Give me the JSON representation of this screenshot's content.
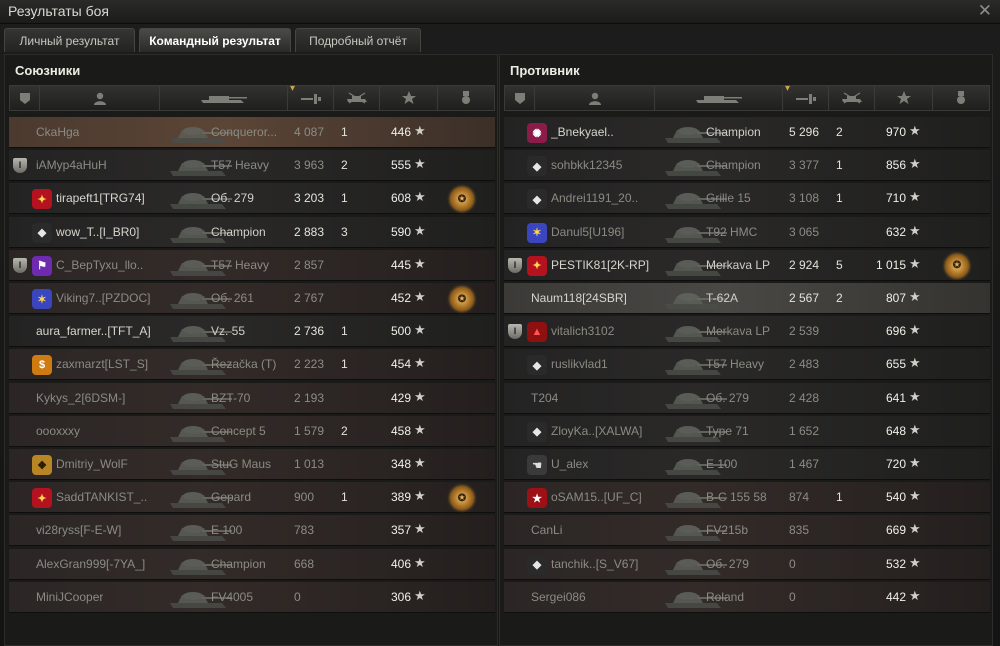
{
  "window": {
    "title": "Результаты боя",
    "close_glyph": "✕"
  },
  "tabs": [
    {
      "label": "Личный результат",
      "active": false
    },
    {
      "label": "Командный результат",
      "active": true
    },
    {
      "label": "Подробный отчёт",
      "active": false
    }
  ],
  "allies": {
    "title": "Союзники",
    "rows": [
      {
        "player": "CkaHga",
        "vehicle": "Conqueror...",
        "damage": "4 087",
        "kills": "1",
        "xp": "446",
        "style": "self",
        "badge": false,
        "clan_icon": "",
        "medal": false,
        "dead": true
      },
      {
        "player": "iAMyp4aHuH",
        "vehicle": "T57 Heavy",
        "damage": "3 963",
        "kills": "2",
        "xp": "555",
        "style": "",
        "badge": true,
        "clan_icon": "",
        "medal": false,
        "dead": true
      },
      {
        "player": "tirapeft1[TRG74]",
        "vehicle": "Об. 279",
        "damage": "3 203",
        "kills": "1",
        "xp": "608",
        "style": "",
        "badge": false,
        "clan_icon": "clan-emblem-red",
        "medal": true,
        "dead": false
      },
      {
        "player": "wow_T..[I_BR0]",
        "vehicle": "Champion",
        "damage": "2 883",
        "kills": "3",
        "xp": "590",
        "style": "",
        "badge": false,
        "clan_icon": "clan-emblem-diamond",
        "medal": false,
        "dead": false
      },
      {
        "player": "C_BepTyxu_llo..",
        "vehicle": "T57 Heavy",
        "damage": "2 857",
        "kills": "",
        "xp": "445",
        "style": "alt",
        "badge": true,
        "clan_icon": "clan-emblem-flag",
        "medal": false,
        "dead": true
      },
      {
        "player": "Viking7..[PZDOC]",
        "vehicle": "Об. 261",
        "damage": "2 767",
        "kills": "",
        "xp": "452",
        "style": "alt",
        "badge": false,
        "clan_icon": "clan-emblem-blue",
        "medal": true,
        "dead": true
      },
      {
        "player": "aura_farmer..[TFT_A]",
        "vehicle": "Vz. 55",
        "damage": "2 736",
        "kills": "1",
        "xp": "500",
        "style": "",
        "badge": false,
        "clan_icon": "",
        "medal": false,
        "dead": false
      },
      {
        "player": "zaxmarzt[LST_S]",
        "vehicle": "Řezačka (T)",
        "damage": "2 223",
        "kills": "1",
        "xp": "454",
        "style": "alt",
        "badge": false,
        "clan_icon": "clan-emblem-dollar",
        "medal": false,
        "dead": true
      },
      {
        "player": "Kykys_2[6DSM-]",
        "vehicle": "BZT-70",
        "damage": "2 193",
        "kills": "",
        "xp": "429",
        "style": "alt",
        "badge": false,
        "clan_icon": "",
        "medal": false,
        "dead": true
      },
      {
        "player": "oooxxxy",
        "vehicle": "Concept 5",
        "damage": "1 579",
        "kills": "2",
        "xp": "458",
        "style": "alt",
        "badge": false,
        "clan_icon": "",
        "medal": false,
        "dead": true
      },
      {
        "player": "Dmitriy_WolF",
        "vehicle": "StuG Maus",
        "damage": "1 013",
        "kills": "",
        "xp": "348",
        "style": "alt",
        "badge": false,
        "clan_icon": "clan-emblem-gold",
        "medal": false,
        "dead": true
      },
      {
        "player": "SaddTANKIST_..",
        "vehicle": "Gepard",
        "damage": "900",
        "kills": "1",
        "xp": "389",
        "style": "alt",
        "badge": false,
        "clan_icon": "clan-emblem-red",
        "medal": true,
        "dead": true
      },
      {
        "player": "vi28ryss[F-E-W]",
        "vehicle": "E 100",
        "damage": "783",
        "kills": "",
        "xp": "357",
        "style": "alt",
        "badge": false,
        "clan_icon": "",
        "medal": false,
        "dead": true
      },
      {
        "player": "AlexGran999[-7YA_]",
        "vehicle": "Champion",
        "damage": "668",
        "kills": "",
        "xp": "406",
        "style": "alt",
        "badge": false,
        "clan_icon": "",
        "medal": false,
        "dead": true
      },
      {
        "player": "MiniJCooper",
        "vehicle": "FV4005",
        "damage": "0",
        "kills": "",
        "xp": "306",
        "style": "alt",
        "badge": false,
        "clan_icon": "",
        "medal": false,
        "dead": true
      }
    ]
  },
  "enemies": {
    "title": "Противник",
    "rows": [
      {
        "player": "_Bnekyael..",
        "vehicle": "Champion",
        "damage": "5 296",
        "kills": "2",
        "xp": "970",
        "style": "",
        "badge": false,
        "clan_icon": "clan-emblem-pink",
        "medal": false,
        "dead": false
      },
      {
        "player": "sohbkk12345",
        "vehicle": "Champion",
        "damage": "3 377",
        "kills": "1",
        "xp": "856",
        "style": "",
        "badge": false,
        "clan_icon": "clan-emblem-diamond",
        "medal": false,
        "dead": true
      },
      {
        "player": "Andrei1191_20..",
        "vehicle": "Grille 15",
        "damage": "3 108",
        "kills": "1",
        "xp": "710",
        "style": "",
        "badge": false,
        "clan_icon": "clan-emblem-diamond",
        "medal": false,
        "dead": true
      },
      {
        "player": "Danul5[U196]",
        "vehicle": "T92 HMC",
        "damage": "3 065",
        "kills": "",
        "xp": "632",
        "style": "",
        "badge": false,
        "clan_icon": "clan-emblem-blue",
        "medal": false,
        "dead": true
      },
      {
        "player": "PESTIK81[2K-RP]",
        "vehicle": "Merkava LP",
        "damage": "2 924",
        "kills": "5",
        "xp": "1 015",
        "style": "",
        "badge": true,
        "clan_icon": "clan-emblem-red",
        "medal": true,
        "dead": false
      },
      {
        "player": "Naum118[24SBR]",
        "vehicle": "T-62A",
        "damage": "2 567",
        "kills": "2",
        "xp": "807",
        "style": "enemyself",
        "badge": false,
        "clan_icon": "",
        "medal": false,
        "dead": false
      },
      {
        "player": "vitalich3102",
        "vehicle": "Merkava LP",
        "damage": "2 539",
        "kills": "",
        "xp": "696",
        "style": "",
        "badge": true,
        "clan_icon": "clan-emblem-warning",
        "medal": false,
        "dead": true
      },
      {
        "player": "ruslikvlad1",
        "vehicle": "T57 Heavy",
        "damage": "2 483",
        "kills": "",
        "xp": "655",
        "style": "",
        "badge": false,
        "clan_icon": "clan-emblem-diamond",
        "medal": false,
        "dead": true
      },
      {
        "player": "T204",
        "vehicle": "Об. 279",
        "damage": "2 428",
        "kills": "",
        "xp": "641",
        "style": "",
        "badge": false,
        "clan_icon": "",
        "medal": false,
        "dead": true
      },
      {
        "player": "ZloyKa..[XALWA]",
        "vehicle": "Type 71",
        "damage": "1 652",
        "kills": "",
        "xp": "648",
        "style": "",
        "badge": false,
        "clan_icon": "clan-emblem-diamond",
        "medal": false,
        "dead": true
      },
      {
        "player": "U_alex",
        "vehicle": "E 100",
        "damage": "1 467",
        "kills": "",
        "xp": "720",
        "style": "",
        "badge": false,
        "clan_icon": "clan-emblem-hand",
        "medal": false,
        "dead": true
      },
      {
        "player": "oSAM15..[UF_C]",
        "vehicle": "B-C 155 58",
        "damage": "874",
        "kills": "1",
        "xp": "540",
        "style": "alt",
        "badge": false,
        "clan_icon": "clan-emblem-star",
        "medal": false,
        "dead": true
      },
      {
        "player": "CanLi",
        "vehicle": "FV215b",
        "damage": "835",
        "kills": "",
        "xp": "669",
        "style": "alt",
        "badge": false,
        "clan_icon": "",
        "medal": false,
        "dead": true
      },
      {
        "player": "tanchik..[S_V67]",
        "vehicle": "Об. 279",
        "damage": "0",
        "kills": "",
        "xp": "532",
        "style": "alt",
        "badge": false,
        "clan_icon": "clan-emblem-diamond",
        "medal": false,
        "dead": true
      },
      {
        "player": "Sergei086",
        "vehicle": "Roland",
        "damage": "0",
        "kills": "",
        "xp": "442",
        "style": "alt",
        "badge": false,
        "clan_icon": "",
        "medal": false,
        "dead": true
      }
    ]
  },
  "colors": {
    "self_row": "#5b4536",
    "enemy_row": "#332b28",
    "medal": "#d49a3a"
  }
}
